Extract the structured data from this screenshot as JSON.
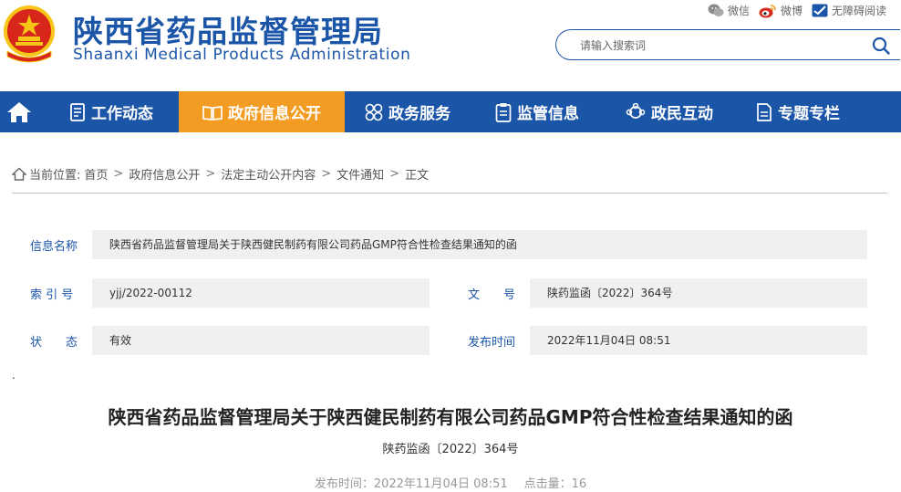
{
  "header": {
    "title_cn": "陕西省药品监督管理局",
    "title_en": "Shaanxi Medical Products Administration",
    "emblem_icon": "national-emblem-icon",
    "top_links": [
      {
        "label": "微信",
        "icon": "wechat-icon"
      },
      {
        "label": "微博",
        "icon": "weibo-icon"
      },
      {
        "label": "无障碍阅读",
        "icon": "accessibility-icon"
      }
    ],
    "search": {
      "placeholder": "请输入搜索词",
      "icon": "search-icon"
    }
  },
  "nav": {
    "home_icon": "home-icon",
    "items": [
      {
        "label": "工作动态",
        "icon": "document-list-icon",
        "active": false
      },
      {
        "label": "政府信息公开",
        "icon": "open-book-icon",
        "active": true
      },
      {
        "label": "政务服务",
        "icon": "four-circles-icon",
        "active": false
      },
      {
        "label": "监管信息",
        "icon": "clipboard-icon",
        "active": false
      },
      {
        "label": "政民互动",
        "icon": "interaction-icon",
        "active": false
      },
      {
        "label": "专题专栏",
        "icon": "folder-doc-icon",
        "active": false
      }
    ]
  },
  "breadcrumb": {
    "prefix": "当前位置:",
    "items": [
      "首页",
      "政府信息公开",
      "法定主动公开内容",
      "文件通知",
      "正文"
    ],
    "separator": ">"
  },
  "info": {
    "name_label": "信息名称",
    "name_value": "陕西省药品监督管理局关于陕西健民制药有限公司药品GMP符合性检查结果通知的函",
    "index_label": "索 引 号",
    "index_value": "yjj/2022-00112",
    "doc_label": "文　　号",
    "doc_value": "陕药监函〔2022〕364号",
    "status_label": "状　　态",
    "status_value": "有效",
    "date_label": "发布时间",
    "date_value": "2022年11月04日 08:51"
  },
  "stray_mark": ".",
  "article": {
    "title": "陕西省药品监督管理局关于陕西健民制药有限公司药品GMP符合性检查结果通知的函",
    "doc_number": "陕药监函〔2022〕364号",
    "publish_label": "发布时间：",
    "publish_time": "2022年11月04日 08:51",
    "views_label": "点击量：",
    "views": "16"
  },
  "colors": {
    "primary": "#1b55a8",
    "accent": "#f39c23",
    "info_bg": "#f0f0f0"
  }
}
